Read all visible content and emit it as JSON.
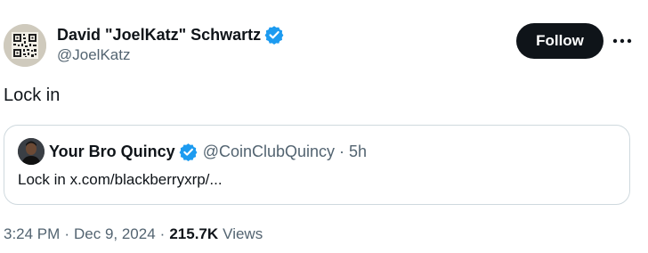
{
  "tweet": {
    "author": {
      "name": "David \"JoelKatz\" Schwartz",
      "handle": "@JoelKatz",
      "verified": true,
      "avatar_icon": "qr-code-avatar"
    },
    "follow_label": "Follow",
    "more_icon": "more-dots-icon",
    "text": "Lock in",
    "quoted": {
      "name": "Your Bro Quincy",
      "handle": "@CoinClubQuincy",
      "separator": "·",
      "time": "5h",
      "text": "Lock in x.com/blackberryxrp/...",
      "verified": true
    },
    "meta": {
      "time": "3:24 PM",
      "date": "Dec 9, 2024",
      "separator": "·",
      "views_count": "215.7K",
      "views_label": "Views"
    }
  },
  "colors": {
    "text_primary": "#0f1419",
    "text_secondary": "#536471",
    "verified_blue": "#1d9bf0",
    "border": "#cfd9de",
    "button_bg": "#0f1419"
  }
}
